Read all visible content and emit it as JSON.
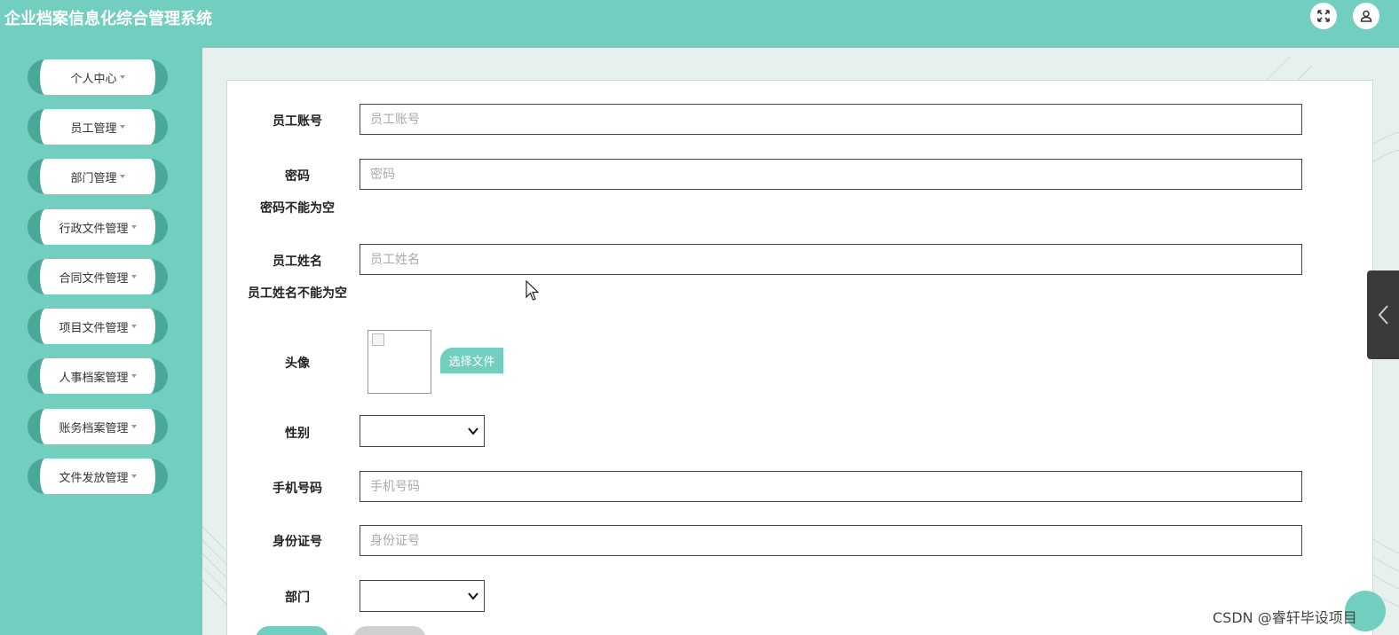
{
  "header": {
    "title": "企业档案信息化综合管理系统",
    "fullscreen_icon": "expand-icon",
    "user_icon": "user-icon"
  },
  "sidebar": {
    "items": [
      {
        "label": "个人中心"
      },
      {
        "label": "员工管理"
      },
      {
        "label": "部门管理"
      },
      {
        "label": "行政文件管理"
      },
      {
        "label": "合同文件管理"
      },
      {
        "label": "项目文件管理"
      },
      {
        "label": "人事档案管理"
      },
      {
        "label": "账务档案管理"
      },
      {
        "label": "文件发放管理"
      }
    ]
  },
  "form": {
    "account": {
      "label": "员工账号",
      "placeholder": "员工账号",
      "value": ""
    },
    "password": {
      "label": "密码",
      "placeholder": "密码",
      "value": "",
      "error": "密码不能为空"
    },
    "name": {
      "label": "员工姓名",
      "placeholder": "员工姓名",
      "value": "",
      "error": "员工姓名不能为空"
    },
    "avatar": {
      "label": "头像",
      "button": "选择文件"
    },
    "gender": {
      "label": "性别",
      "selected": ""
    },
    "phone": {
      "label": "手机号码",
      "placeholder": "手机号码",
      "value": ""
    },
    "idcard": {
      "label": "身份证号",
      "placeholder": "身份证号",
      "value": ""
    },
    "department": {
      "label": "部门",
      "selected": ""
    }
  },
  "watermark": "CSDN @睿轩毕设项目",
  "colors": {
    "primary": "#72cfc0",
    "sidebar_accent": "#4aa898",
    "side_tab": "#3a3a3a"
  }
}
